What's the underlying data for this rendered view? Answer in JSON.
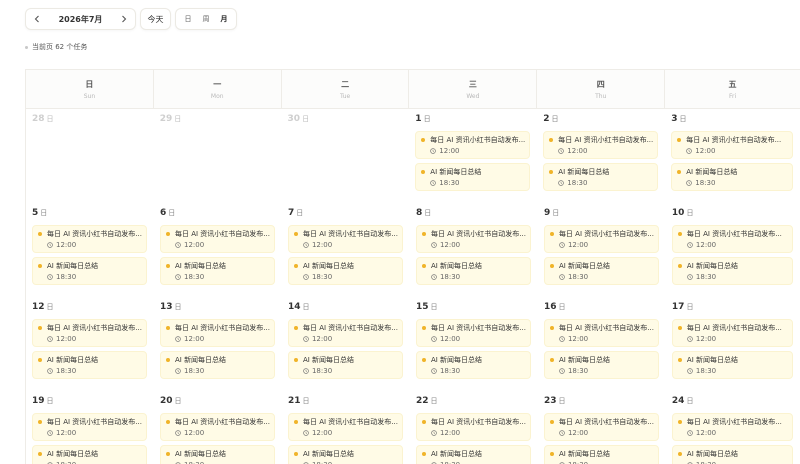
{
  "toolbar": {
    "month_label": "2026年7月",
    "today_label": "今天",
    "views": [
      "日",
      "周",
      "月"
    ],
    "active_view": "月"
  },
  "task_count": "当前页 62 个任务",
  "weekdays": [
    {
      "cn": "日",
      "en": "Sun"
    },
    {
      "cn": "一",
      "en": "Mon"
    },
    {
      "cn": "二",
      "en": "Tue"
    },
    {
      "cn": "三",
      "en": "Wed"
    },
    {
      "cn": "四",
      "en": "Thu"
    },
    {
      "cn": "五",
      "en": "Fri"
    }
  ],
  "day_suffix": "日",
  "event_templates": {
    "noon": {
      "title": "每日 AI 资讯小红书自动发布...",
      "time": "12:00"
    },
    "evening": {
      "title": "AI 新闻每日总结",
      "time": "18:30"
    }
  },
  "weeks": [
    [
      {
        "day": "28",
        "other": true,
        "events": []
      },
      {
        "day": "29",
        "other": true,
        "events": []
      },
      {
        "day": "30",
        "other": true,
        "events": []
      },
      {
        "day": "1",
        "other": false,
        "events": [
          "noon",
          "evening"
        ]
      },
      {
        "day": "2",
        "other": false,
        "events": [
          "noon",
          "evening"
        ]
      },
      {
        "day": "3",
        "other": false,
        "events": [
          "noon",
          "evening"
        ]
      }
    ],
    [
      {
        "day": "5",
        "other": false,
        "events": [
          "noon",
          "evening"
        ]
      },
      {
        "day": "6",
        "other": false,
        "events": [
          "noon",
          "evening"
        ]
      },
      {
        "day": "7",
        "other": false,
        "events": [
          "noon",
          "evening"
        ]
      },
      {
        "day": "8",
        "other": false,
        "events": [
          "noon",
          "evening"
        ]
      },
      {
        "day": "9",
        "other": false,
        "events": [
          "noon",
          "evening"
        ]
      },
      {
        "day": "10",
        "other": false,
        "events": [
          "noon",
          "evening"
        ]
      }
    ],
    [
      {
        "day": "12",
        "other": false,
        "events": [
          "noon",
          "evening"
        ]
      },
      {
        "day": "13",
        "other": false,
        "events": [
          "noon",
          "evening"
        ]
      },
      {
        "day": "14",
        "other": false,
        "events": [
          "noon",
          "evening"
        ]
      },
      {
        "day": "15",
        "other": false,
        "events": [
          "noon",
          "evening"
        ]
      },
      {
        "day": "16",
        "other": false,
        "events": [
          "noon",
          "evening"
        ]
      },
      {
        "day": "17",
        "other": false,
        "events": [
          "noon",
          "evening"
        ]
      }
    ],
    [
      {
        "day": "19",
        "other": false,
        "events": [
          "noon",
          "evening"
        ]
      },
      {
        "day": "20",
        "other": false,
        "events": [
          "noon",
          "evening"
        ]
      },
      {
        "day": "21",
        "other": false,
        "events": [
          "noon",
          "evening"
        ]
      },
      {
        "day": "22",
        "other": false,
        "events": [
          "noon",
          "evening"
        ]
      },
      {
        "day": "23",
        "other": false,
        "events": [
          "noon",
          "evening"
        ]
      },
      {
        "day": "24",
        "other": false,
        "events": [
          "noon",
          "evening"
        ]
      }
    ]
  ],
  "colors": {
    "event_bg": "#fffbe6",
    "event_dot": "#f0b429",
    "other_month": "#cfcfcf"
  },
  "icons": {
    "prev": "chevron-left-icon",
    "next": "chevron-right-icon",
    "time": "clock-icon",
    "event": "event-dot-icon"
  }
}
